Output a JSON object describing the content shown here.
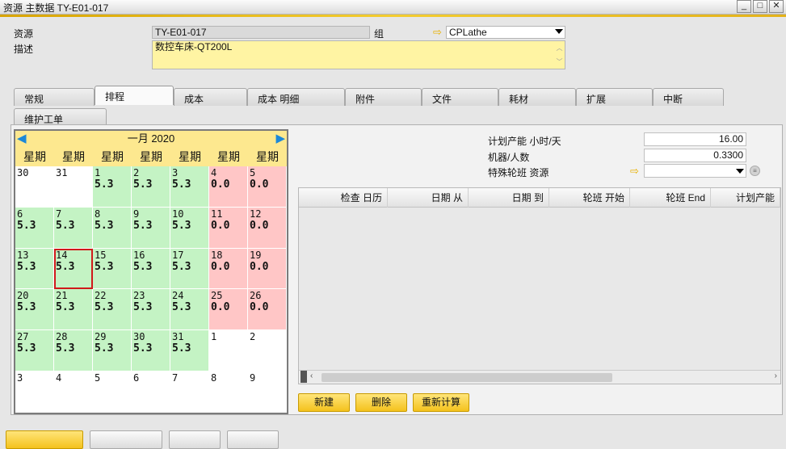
{
  "window": {
    "title": "资源 主数据 TY-E01-017"
  },
  "header": {
    "resource_label": "资源",
    "resource_value": "TY-E01-017",
    "group_label": "组",
    "group_value": "CPLathe",
    "desc_label": "描述",
    "desc_value": "数控车床-QT200L"
  },
  "tabs": [
    "常规",
    "排程",
    "成本",
    "成本 明细",
    "附件",
    "文件",
    "耗材",
    "扩展",
    "中断",
    "维护工单"
  ],
  "active_tab": "排程",
  "calendar": {
    "month_label": "一月 2020",
    "weekday_labels": [
      "星期",
      "星期",
      "星期",
      "星期",
      "星期",
      "星期",
      "星期"
    ],
    "selected_day": "14",
    "weeks": [
      [
        {
          "d": "30",
          "h": "",
          "t": "e"
        },
        {
          "d": "31",
          "h": "",
          "t": "e"
        },
        {
          "d": "1",
          "h": "5.3",
          "t": "w"
        },
        {
          "d": "2",
          "h": "5.3",
          "t": "w"
        },
        {
          "d": "3",
          "h": "5.3",
          "t": "w"
        },
        {
          "d": "4",
          "h": "0.0",
          "t": "o"
        },
        {
          "d": "5",
          "h": "0.0",
          "t": "o"
        }
      ],
      [
        {
          "d": "6",
          "h": "5.3",
          "t": "w"
        },
        {
          "d": "7",
          "h": "5.3",
          "t": "w"
        },
        {
          "d": "8",
          "h": "5.3",
          "t": "w"
        },
        {
          "d": "9",
          "h": "5.3",
          "t": "w"
        },
        {
          "d": "10",
          "h": "5.3",
          "t": "w"
        },
        {
          "d": "11",
          "h": "0.0",
          "t": "o"
        },
        {
          "d": "12",
          "h": "0.0",
          "t": "o"
        }
      ],
      [
        {
          "d": "13",
          "h": "5.3",
          "t": "w"
        },
        {
          "d": "14",
          "h": "5.3",
          "t": "w"
        },
        {
          "d": "15",
          "h": "5.3",
          "t": "w"
        },
        {
          "d": "16",
          "h": "5.3",
          "t": "w"
        },
        {
          "d": "17",
          "h": "5.3",
          "t": "w"
        },
        {
          "d": "18",
          "h": "0.0",
          "t": "o"
        },
        {
          "d": "19",
          "h": "0.0",
          "t": "o"
        }
      ],
      [
        {
          "d": "20",
          "h": "5.3",
          "t": "w"
        },
        {
          "d": "21",
          "h": "5.3",
          "t": "w"
        },
        {
          "d": "22",
          "h": "5.3",
          "t": "w"
        },
        {
          "d": "23",
          "h": "5.3",
          "t": "w"
        },
        {
          "d": "24",
          "h": "5.3",
          "t": "w"
        },
        {
          "d": "25",
          "h": "0.0",
          "t": "o"
        },
        {
          "d": "26",
          "h": "0.0",
          "t": "o"
        }
      ],
      [
        {
          "d": "27",
          "h": "5.3",
          "t": "w"
        },
        {
          "d": "28",
          "h": "5.3",
          "t": "w"
        },
        {
          "d": "29",
          "h": "5.3",
          "t": "w"
        },
        {
          "d": "30",
          "h": "5.3",
          "t": "w"
        },
        {
          "d": "31",
          "h": "5.3",
          "t": "w"
        },
        {
          "d": "1",
          "h": "",
          "t": "e"
        },
        {
          "d": "2",
          "h": "",
          "t": "e"
        }
      ],
      [
        {
          "d": "3",
          "h": "",
          "t": "e"
        },
        {
          "d": "4",
          "h": "",
          "t": "e"
        },
        {
          "d": "5",
          "h": "",
          "t": "e"
        },
        {
          "d": "6",
          "h": "",
          "t": "e"
        },
        {
          "d": "7",
          "h": "",
          "t": "e"
        },
        {
          "d": "8",
          "h": "",
          "t": "e"
        },
        {
          "d": "9",
          "h": "",
          "t": "e"
        }
      ]
    ]
  },
  "capacity": {
    "planned_label": "计划产能 小时/天",
    "planned_value": "16.00",
    "machines_label": "机器/人数",
    "machines_value": "0.3300",
    "special_label": "特殊轮班 资源",
    "special_value": ""
  },
  "table": {
    "columns": [
      "检查 日历",
      "日期 从",
      "日期 到",
      "轮班 开始",
      "轮班 End",
      "计划产能"
    ]
  },
  "actions": {
    "new": "新建",
    "delete": "删除",
    "recalc": "重新计算"
  },
  "colors": {
    "working_day": "#c4f3c4",
    "off_day": "#ffc6c6",
    "accent": "#f4c21d",
    "selected_outline": "#d01a1a"
  }
}
